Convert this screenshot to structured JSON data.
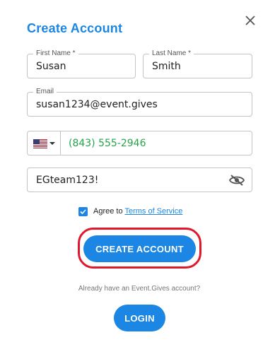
{
  "dialog": {
    "title": "Create Account",
    "close_icon": "close-icon"
  },
  "form": {
    "first_name": {
      "label": "First Name *",
      "value": "Susan"
    },
    "last_name": {
      "label": "Last Name *",
      "value": "Smith"
    },
    "email": {
      "label": "Email",
      "value": "susan1234@event.gives"
    },
    "phone": {
      "country_flag_icon": "us-flag-icon",
      "value": "(843) 555-2946"
    },
    "password": {
      "value": "EGteam123!",
      "visibility_icon": "eye-slash-icon"
    },
    "agree": {
      "checked": true,
      "text": "Agree to",
      "link": "Terms of Service"
    }
  },
  "actions": {
    "create_account_label": "CREATE ACCOUNT",
    "already_text": "Already have an Event.Gives account?",
    "login_label": "LOGIN"
  },
  "colors": {
    "accent": "#1b86e3",
    "highlight": "#e0182d",
    "phone_text": "#27a34a"
  }
}
